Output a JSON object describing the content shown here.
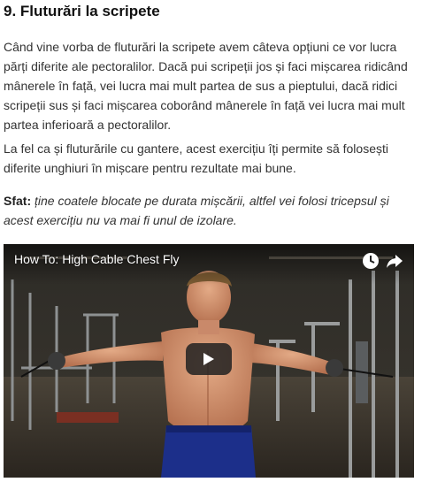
{
  "article": {
    "heading": "9. Fluturări la scripete",
    "paragraph1": "Când vine vorba de fluturări la scripete avem câteva opțiuni ce vor lucra părți diferite ale pectoralilor. Dacă pui scripeții jos și faci mișcarea ridicând mânerele în față, vei lucra mai mult partea de sus a pieptului, dacă ridici scripeții sus și faci mișcarea coborând mânerele în față vei lucra mai mult partea inferioară a pectoralilor.",
    "paragraph2": "La fel ca și fluturările cu gantere, acest exercițiu îți permite să folosești diferite unghiuri în mișcare pentru rezultate mai bune.",
    "tip_label": "Sfat:",
    "tip_text": " ține coatele blocate pe durata mișcării, altfel vei folosi tricepsul și acest exercițiu nu va mai fi unul de izolare."
  },
  "video": {
    "title": "How To: High Cable Chest Fly",
    "icons": {
      "watch_later": "clock-icon",
      "share": "share-arrow-icon",
      "play": "play-icon"
    }
  },
  "colors": {
    "heading": "#111111",
    "text": "#333333",
    "play_button_bg": "#212121"
  }
}
